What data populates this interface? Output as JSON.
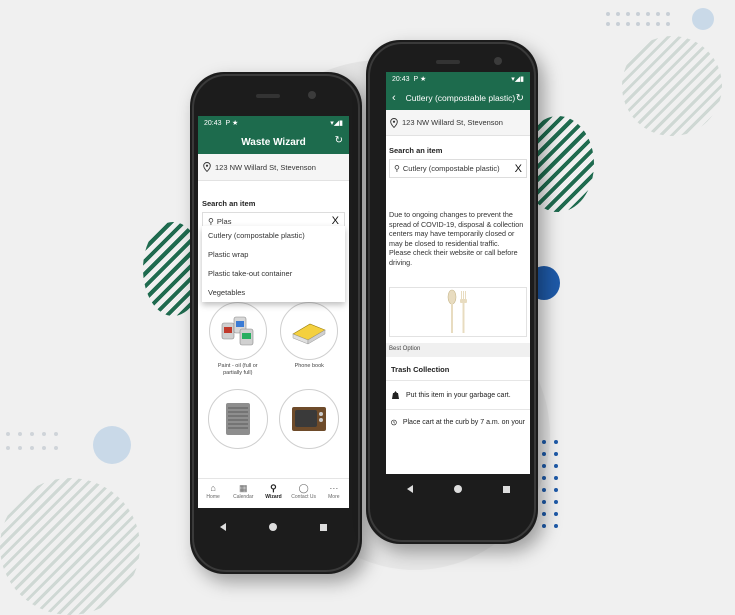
{
  "colors": {
    "brand_green": "#1d6b4d",
    "accent_blue": "#1e5aa8",
    "background": "#f0f0f0"
  },
  "phone_left": {
    "status": {
      "time": "20:43",
      "icons": "P ★",
      "right": "▾◢▮"
    },
    "header": {
      "title": "Waste Wizard",
      "refresh_icon": "refresh-icon"
    },
    "address": "123 NW Willard St, Stevenson",
    "search": {
      "label": "Search an item",
      "value": "Plas",
      "clear": "X"
    },
    "suggestions": [
      "Cutlery (compostable plastic)",
      "Plastic wrap",
      "Plastic take-out container",
      "Vegetables"
    ],
    "tiles": [
      {
        "label": "Paint - oil (full or partially full)",
        "icon": "paint-cans-icon"
      },
      {
        "label": "Phone book",
        "icon": "phone-book-icon"
      },
      {
        "label": "",
        "icon": "air-conditioner-icon"
      },
      {
        "label": "",
        "icon": "television-icon"
      }
    ],
    "bottom_nav": [
      {
        "label": "Home",
        "icon": "home-icon"
      },
      {
        "label": "Calendar",
        "icon": "calendar-icon"
      },
      {
        "label": "Wizard",
        "icon": "wizard-icon"
      },
      {
        "label": "Contact Us",
        "icon": "chat-icon"
      },
      {
        "label": "More",
        "icon": "more-icon"
      }
    ]
  },
  "phone_right": {
    "status": {
      "time": "20:43",
      "icons": "P ★",
      "right": "▾◢▮"
    },
    "header": {
      "title": "Cutlery (compostable plastic)",
      "back": "‹",
      "refresh_icon": "refresh-icon"
    },
    "address": "123 NW Willard St, Stevenson",
    "search": {
      "label": "Search an item",
      "value": "Cutlery (compostable plastic)",
      "clear": "X"
    },
    "notice": "Due to ongoing changes to prevent the spread of COVID-19, disposal & collection centers may have temporarily closed or may be closed to residential traffic.\nPlease check their website or call before driving.",
    "best_option_label": "Best Option",
    "collection_title": "Trash Collection",
    "instructions": [
      "Put this item in your garbage cart.",
      "Place cart at the curb by 7 a.m. on your"
    ]
  }
}
